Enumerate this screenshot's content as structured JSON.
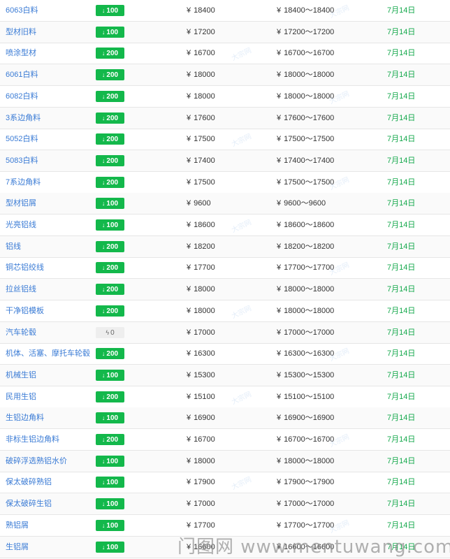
{
  "currency_symbol": "¥",
  "colors": {
    "name": "#3a7bd5",
    "down_badge": "#13b84b",
    "flat_badge": "#eeeeee",
    "date": "#13a84b"
  },
  "rows": [
    {
      "name": "6063白料",
      "change": "100",
      "direction": "down",
      "price": "18400",
      "range": "18400～18400",
      "date": "7月14日"
    },
    {
      "name": "型材旧料",
      "change": "100",
      "direction": "down",
      "price": "17200",
      "range": "17200～17200",
      "date": "7月14日"
    },
    {
      "name": "喷涂型材",
      "change": "200",
      "direction": "down",
      "price": "16700",
      "range": "16700～16700",
      "date": "7月14日"
    },
    {
      "name": "6061白料",
      "change": "200",
      "direction": "down",
      "price": "18000",
      "range": "18000～18000",
      "date": "7月14日"
    },
    {
      "name": "6082白料",
      "change": "200",
      "direction": "down",
      "price": "18000",
      "range": "18000～18000",
      "date": "7月14日"
    },
    {
      "name": "3系边角料",
      "change": "200",
      "direction": "down",
      "price": "17600",
      "range": "17600～17600",
      "date": "7月14日"
    },
    {
      "name": "5052白料",
      "change": "200",
      "direction": "down",
      "price": "17500",
      "range": "17500～17500",
      "date": "7月14日"
    },
    {
      "name": "5083白料",
      "change": "200",
      "direction": "down",
      "price": "17400",
      "range": "17400～17400",
      "date": "7月14日"
    },
    {
      "name": "7系边角料",
      "change": "200",
      "direction": "down",
      "price": "17500",
      "range": "17500～17500",
      "date": "7月14日"
    },
    {
      "name": "型材铝屑",
      "change": "100",
      "direction": "down",
      "price": "9600",
      "range": "9600～9600",
      "date": "7月14日"
    },
    {
      "name": "光亮铝线",
      "change": "100",
      "direction": "down",
      "price": "18600",
      "range": "18600～18600",
      "date": "7月14日"
    },
    {
      "name": "铝线",
      "change": "200",
      "direction": "down",
      "price": "18200",
      "range": "18200～18200",
      "date": "7月14日"
    },
    {
      "name": "铜芯铝绞线",
      "change": "200",
      "direction": "down",
      "price": "17700",
      "range": "17700～17700",
      "date": "7月14日"
    },
    {
      "name": "拉丝铝线",
      "change": "200",
      "direction": "down",
      "price": "18000",
      "range": "18000～18000",
      "date": "7月14日"
    },
    {
      "name": "干净铝模板",
      "change": "200",
      "direction": "down",
      "price": "18000",
      "range": "18000～18000",
      "date": "7月14日"
    },
    {
      "name": "汽车轮毂",
      "change": "0",
      "direction": "flat",
      "price": "17000",
      "range": "17000～17000",
      "date": "7月14日"
    },
    {
      "name": "机体、活塞、摩托车轮毂",
      "change": "200",
      "direction": "down",
      "price": "16300",
      "range": "16300～16300",
      "date": "7月14日"
    },
    {
      "name": "机械生铝",
      "change": "100",
      "direction": "down",
      "price": "15300",
      "range": "15300～15300",
      "date": "7月14日"
    },
    {
      "name": "民用生铝",
      "change": "200",
      "direction": "down",
      "price": "15100",
      "range": "15100～15100",
      "date": "7月14日"
    },
    {
      "name": "生铝边角料",
      "change": "100",
      "direction": "down",
      "price": "16900",
      "range": "16900～16900",
      "date": "7月14日"
    },
    {
      "name": "非标生铝边角料",
      "change": "200",
      "direction": "down",
      "price": "16700",
      "range": "16700～16700",
      "date": "7月14日"
    },
    {
      "name": "破碎浮选熟铝水价",
      "change": "100",
      "direction": "down",
      "price": "18000",
      "range": "18000～18000",
      "date": "7月14日"
    },
    {
      "name": "保太破碎熟铝",
      "change": "100",
      "direction": "down",
      "price": "17900",
      "range": "17900～17900",
      "date": "7月14日"
    },
    {
      "name": "保太破碎生铝",
      "change": "100",
      "direction": "down",
      "price": "17000",
      "range": "17000～17000",
      "date": "7月14日"
    },
    {
      "name": "熟铝屑",
      "change": "100",
      "direction": "down",
      "price": "17700",
      "range": "17700～17700",
      "date": "7月14日"
    },
    {
      "name": "生铝屑",
      "change": "100",
      "direction": "down",
      "price": "16600",
      "range": "16600～16600",
      "date": "7月14日"
    }
  ],
  "row_watermark": "大宗网",
  "footer_watermark": "门图网 www.mentuwang.com"
}
